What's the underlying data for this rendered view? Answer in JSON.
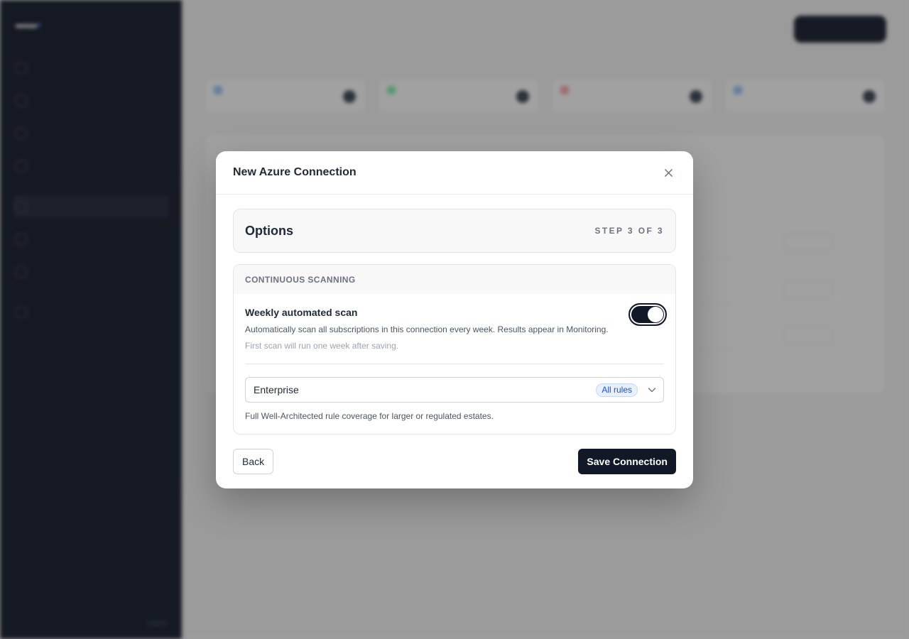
{
  "background": {
    "brand": "",
    "nav": [
      "",
      "",
      "",
      "",
      "",
      "",
      "",
      ""
    ],
    "page_title": "",
    "page_subtitle": "",
    "user": ""
  },
  "modal": {
    "title": "New Azure Connection",
    "step": {
      "title": "Options",
      "counter": "STEP 3 OF 3"
    },
    "section": {
      "heading": "CONTINUOUS SCANNING",
      "scan": {
        "title": "Weekly automated scan",
        "description": "Automatically scan all subscriptions in this connection every week. Results appear in Monitoring.",
        "note": "First scan will run one week after saving.",
        "enabled": true
      },
      "ruleset": {
        "value": "Enterprise",
        "badge": "All rules",
        "help": "Full Well-Architected rule coverage for larger or regulated estates."
      }
    },
    "buttons": {
      "back": "Back",
      "save": "Save Connection"
    }
  },
  "colors": {
    "primary": "#111827",
    "badge_bg": "#e8f0fe",
    "badge_text": "#1d4ed8",
    "sidebar_bg": "#0f1524"
  },
  "icons": {
    "close": "close-icon",
    "chevron": "chevron-down-icon"
  }
}
